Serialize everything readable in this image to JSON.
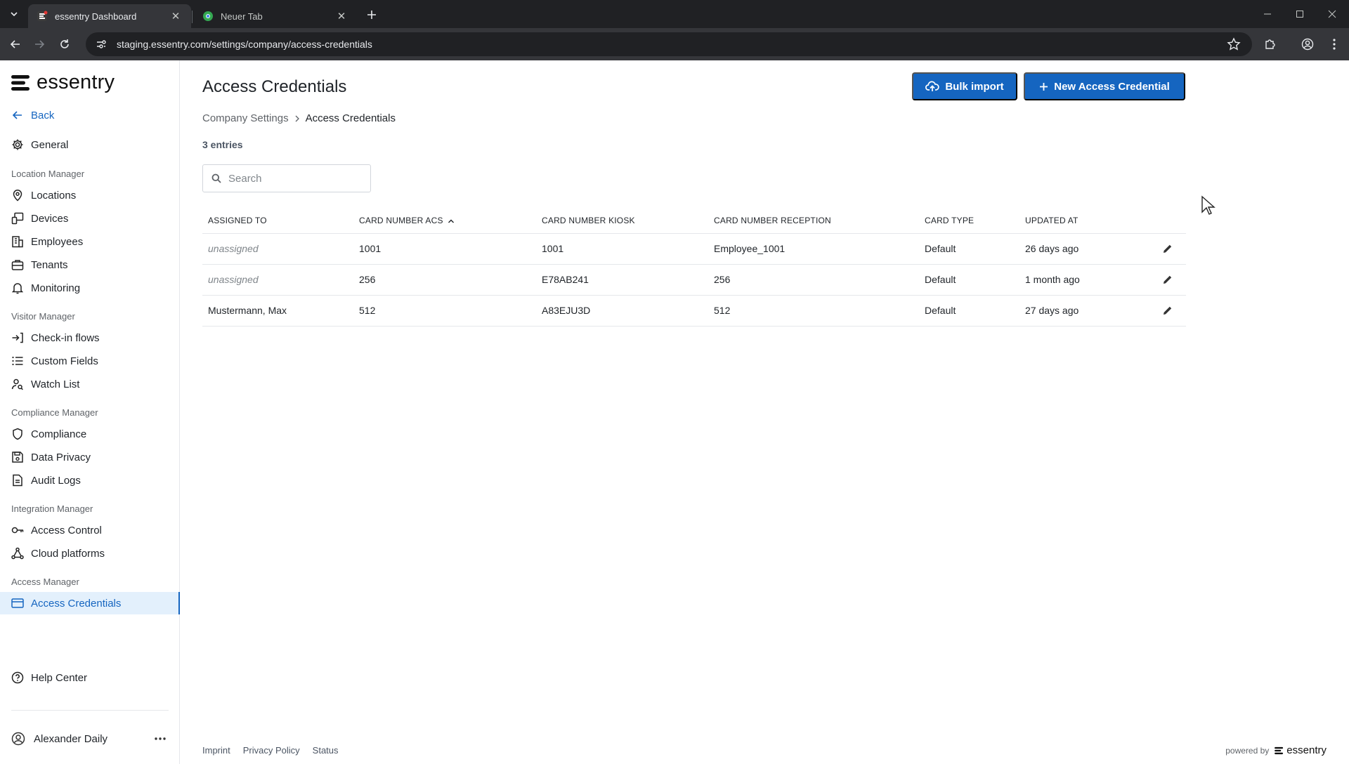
{
  "browser": {
    "tabs": [
      {
        "title": "essentry Dashboard",
        "active": true
      },
      {
        "title": "Neuer Tab",
        "active": false
      }
    ],
    "url": "staging.essentry.com/settings/company/access-credentials"
  },
  "sidebar": {
    "logo_text": "essentry",
    "back_label": "Back",
    "general_label": "General",
    "groups": {
      "location_manager": "Location Manager",
      "visitor_manager": "Visitor Manager",
      "compliance_manager": "Compliance Manager",
      "integration_manager": "Integration Manager",
      "access_manager": "Access Manager"
    },
    "items": {
      "locations": "Locations",
      "devices": "Devices",
      "employees": "Employees",
      "tenants": "Tenants",
      "monitoring": "Monitoring",
      "checkin_flows": "Check-in flows",
      "custom_fields": "Custom Fields",
      "watch_list": "Watch List",
      "compliance": "Compliance",
      "data_privacy": "Data Privacy",
      "audit_logs": "Audit Logs",
      "access_control": "Access Control",
      "cloud_platforms": "Cloud platforms",
      "access_credentials": "Access Credentials"
    },
    "help_center": "Help Center",
    "user_name": "Alexander Daily"
  },
  "page": {
    "title": "Access Credentials",
    "bulk_import_label": "Bulk import",
    "new_credential_label": "New Access Credential",
    "breadcrumb": {
      "parent": "Company Settings",
      "current": "Access Credentials"
    },
    "entries_count": "3 entries",
    "search_placeholder": "Search"
  },
  "table": {
    "columns": [
      "ASSIGNED TO",
      "CARD NUMBER ACS",
      "CARD NUMBER KIOSK",
      "CARD NUMBER RECEPTION",
      "CARD TYPE",
      "UPDATED AT"
    ],
    "rows": [
      {
        "assigned_to": "unassigned",
        "acs": "1001",
        "kiosk": "1001",
        "reception": "Employee_1001",
        "card_type": "Default",
        "updated_at": "26 days ago"
      },
      {
        "assigned_to": "unassigned",
        "acs": "256",
        "kiosk": "E78AB241",
        "reception": "256",
        "card_type": "Default",
        "updated_at": "1 month ago"
      },
      {
        "assigned_to": "Mustermann, Max",
        "acs": "512",
        "kiosk": "A83EJU3D",
        "reception": "512",
        "card_type": "Default",
        "updated_at": "27 days ago"
      }
    ]
  },
  "footer": {
    "links": [
      "Imprint",
      "Privacy Policy",
      "Status"
    ],
    "powered_by": "powered by",
    "brand": "essentry"
  },
  "colors": {
    "accent": "#1565c0",
    "active_bg": "#e3f0fc",
    "chrome_dark": "#202124",
    "chrome_toolbar": "#35363a"
  }
}
